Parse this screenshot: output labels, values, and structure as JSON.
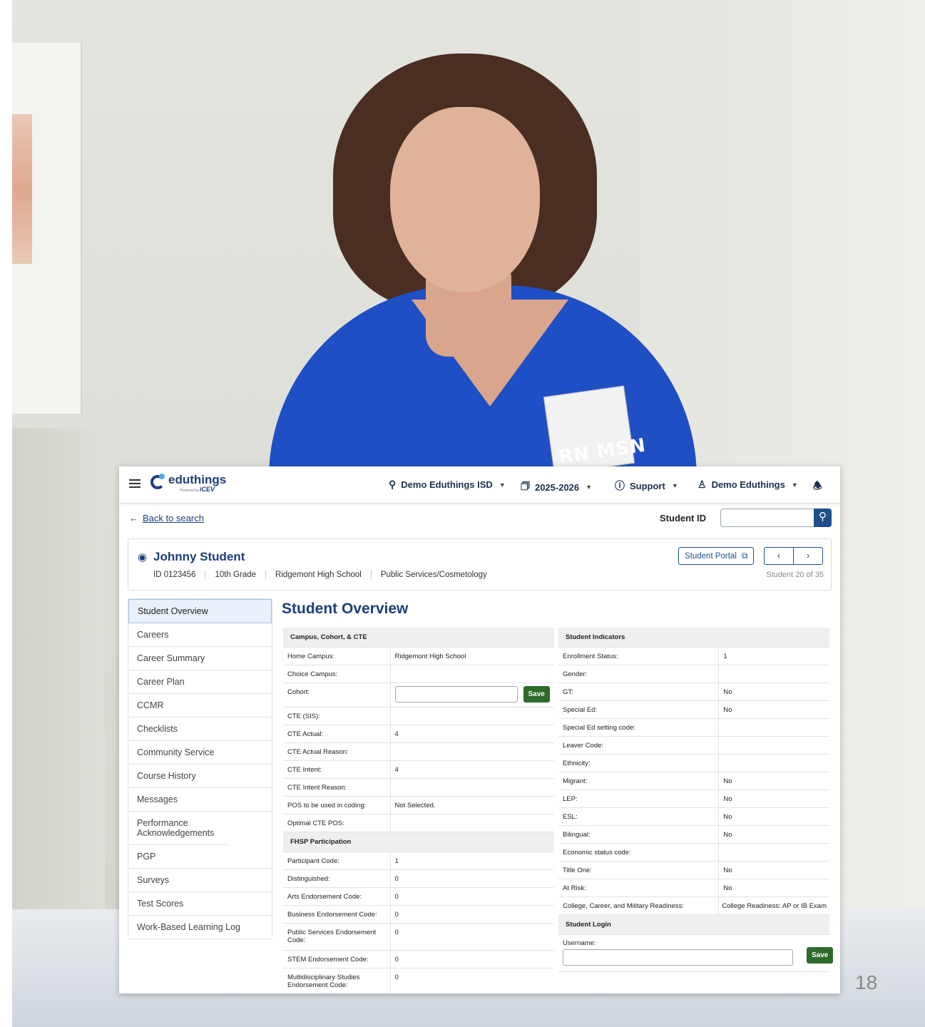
{
  "slide": {
    "page_number": "18",
    "badge_text": "RN MSN"
  },
  "header": {
    "logo": {
      "name": "eduthings",
      "powered_by": "Powered by",
      "brand": "iCEV"
    },
    "district": "Demo Eduthings ISD",
    "year": "2025-2026",
    "support": "Support",
    "user": "Demo Eduthings"
  },
  "subbar": {
    "back": "Back to search",
    "student_id_label": "Student ID",
    "student_id_value": ""
  },
  "student": {
    "name": "Johnny Student",
    "id": "ID 0123456",
    "grade": "10th Grade",
    "school": "Ridgemont High School",
    "program": "Public Services/Cosmetology",
    "portal_label": "Student Portal",
    "position": "Student 20 of 35"
  },
  "sidebar": {
    "items": [
      {
        "label": "Student Overview",
        "active": true
      },
      {
        "label": "Careers"
      },
      {
        "label": "Career Summary"
      },
      {
        "label": "Career Plan"
      },
      {
        "label": "CCMR"
      },
      {
        "label": "Checklists"
      },
      {
        "label": "Community Service"
      },
      {
        "label": "Course History"
      },
      {
        "label": "Messages"
      },
      {
        "label": "Performance Acknowledgements"
      },
      {
        "label": "PGP"
      },
      {
        "label": "Surveys"
      },
      {
        "label": "Test Scores"
      },
      {
        "label": "Work-Based Learning Log"
      }
    ]
  },
  "main": {
    "title": "Student Overview",
    "left": {
      "section1": "Campus, Cohort, & CTE",
      "rows1": [
        {
          "k": "Home Campus:",
          "v": "Ridgemont High School"
        },
        {
          "k": "Choice Campus:",
          "v": ""
        },
        {
          "k": "Cohort:",
          "v": ""
        },
        {
          "k": "CTE (SIS):",
          "v": ""
        },
        {
          "k": "CTE Actual:",
          "v": "4"
        },
        {
          "k": "CTE Actual Reason:",
          "v": ""
        },
        {
          "k": "CTE Intent:",
          "v": "4"
        },
        {
          "k": "CTE Intent Reason:",
          "v": ""
        },
        {
          "k": "POS to be used in coding:",
          "v": "Not Selected."
        },
        {
          "k": "Optimal CTE POS:",
          "v": ""
        }
      ],
      "section2": "FHSP Participation",
      "rows2": [
        {
          "k": "Participant Code:",
          "v": "1"
        },
        {
          "k": "Distinguished:",
          "v": "0"
        },
        {
          "k": "Arts Endorsement Code:",
          "v": "0"
        },
        {
          "k": "Business Endorsement Code:",
          "v": "0"
        },
        {
          "k": "Public Services Endorsement Code:",
          "v": "0"
        },
        {
          "k": "STEM Endorsement Code:",
          "v": "0"
        },
        {
          "k": "Multidisciplinary Studies Endorsement Code:",
          "v": "0"
        }
      ],
      "save_label": "Save"
    },
    "right": {
      "section1": "Student Indicators",
      "rows1": [
        {
          "k": "Enrollment Status:",
          "v": "1"
        },
        {
          "k": "Gender:",
          "v": ""
        },
        {
          "k": "GT:",
          "v": "No"
        },
        {
          "k": "Special Ed:",
          "v": "No"
        },
        {
          "k": "Special Ed setting code:",
          "v": ""
        },
        {
          "k": "Leaver Code:",
          "v": ""
        },
        {
          "k": "Ethnicity:",
          "v": ""
        },
        {
          "k": "Migrant:",
          "v": "No"
        },
        {
          "k": "LEP:",
          "v": "No"
        },
        {
          "k": "ESL:",
          "v": "No"
        },
        {
          "k": "Bilingual:",
          "v": "No"
        },
        {
          "k": "Economic status code:",
          "v": ""
        },
        {
          "k": "Title One:",
          "v": "No"
        },
        {
          "k": "At Risk:",
          "v": "No"
        },
        {
          "k": "College, Career, and Military Readiness:",
          "v": "College Readiness: AP or IB Exam"
        }
      ],
      "section2": "Student Login",
      "username_label": "Username:",
      "username_value": "",
      "save_label": "Save"
    }
  }
}
